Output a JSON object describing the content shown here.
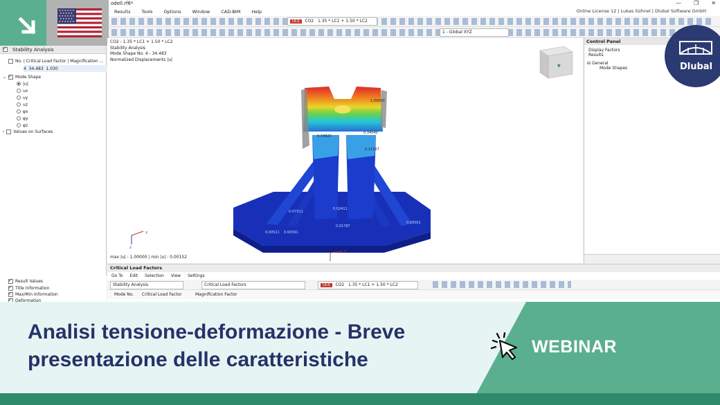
{
  "window": {
    "title": "odell.rf6*",
    "license": "Online License 12 | Lukas Sühnel | Dlubal Software GmbH",
    "controls": [
      "—",
      "❐",
      "✕"
    ]
  },
  "menu": [
    "Results",
    "Tools",
    "Options",
    "Window",
    "CAD-BIM",
    "Help"
  ],
  "toolbar": {
    "uls_badge": "ULS",
    "combo_name": "CO2",
    "combo_formula": "1.35 * LC1 + 1.50 * LC2",
    "coord_system": "1 - Global XYZ"
  },
  "navigator": {
    "title": "Stability Analysis",
    "column_header": "No. | Critical Load Factor | Magnification ...",
    "value_row": {
      "no": "4",
      "factor": "34.483",
      "magnification": "1.030"
    },
    "mode_shape": "Mode Shape",
    "components": [
      "|u|",
      "ux",
      "uy",
      "uz",
      "φx",
      "φy",
      "φz"
    ],
    "values_on_surfaces": "Values on Surfaces",
    "bottom_items": [
      "Result Values",
      "Title Information",
      "Max/Min Information",
      "Deformation"
    ]
  },
  "viewport": {
    "info_lines": [
      "CO2 - 1.35 * LC1 + 1.50 * LC2",
      "Stability Analysis",
      "Mode Shape No. 4 - 34.483",
      "Normalized Displacements |u|"
    ],
    "max_min": "max |u| : 1.00000 | min |u| : 0.00152",
    "axis_x": "x",
    "axis_z": "z",
    "axis_y": "y",
    "labels": [
      "1.00000",
      "0.34540",
      "0.34820",
      "0.11167",
      "0.07311",
      "0.02411",
      "0.01787",
      "0.00561",
      "0.00521",
      "0.00391"
    ]
  },
  "control_panel": {
    "title": "Control Panel",
    "lines": [
      "Display Factors",
      "Results"
    ],
    "tree": [
      "General",
      "Mode Shapes"
    ]
  },
  "bottom_panel": {
    "title": "Critical Load Factors",
    "menu": [
      "Go To",
      "Edit",
      "Selection",
      "View",
      "Settings"
    ],
    "combo_analysis": "Stability Analysis",
    "combo_table": "Critical Load Factors",
    "uls_badge": "ULS",
    "combo_name": "CO2",
    "combo_formula": "1.35 * LC1 + 1.50 * LC2",
    "columns": [
      "Mode No.",
      "Critical Load Factor",
      "Magnification Factor"
    ]
  },
  "brand": {
    "name": "Dlubal",
    "color": "#2c3a72"
  },
  "banner": {
    "headline_line1": "Analisi tensione-deformazione - Breve",
    "headline_line2": "presentazione delle caratteristiche",
    "tag": "WEBINAR"
  },
  "colors": {
    "accent_green": "#5aaf8f",
    "dark_green": "#2f8a6c",
    "navy": "#263268",
    "light_teal": "#e6f5f3"
  }
}
